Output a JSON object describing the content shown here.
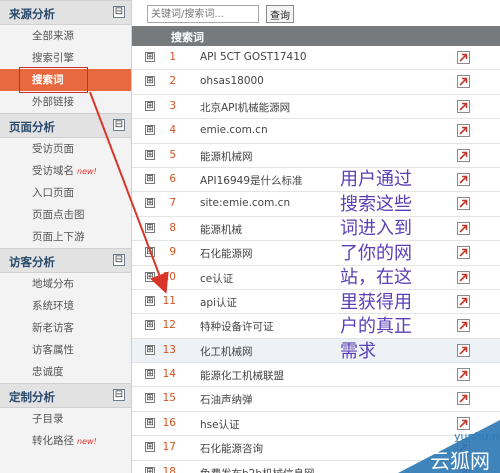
{
  "sidebar": {
    "sections": [
      {
        "title": "来源分析",
        "toggle": "⊟",
        "items": [
          {
            "label": "全部来源",
            "active": false,
            "new": false
          },
          {
            "label": "搜索引擎",
            "active": false,
            "new": false
          },
          {
            "label": "搜索词",
            "active": true,
            "new": false
          },
          {
            "label": "外部链接",
            "active": false,
            "new": false
          }
        ]
      },
      {
        "title": "页面分析",
        "toggle": "⊟",
        "items": [
          {
            "label": "受访页面",
            "active": false,
            "new": false
          },
          {
            "label": "受访域名",
            "active": false,
            "new": true
          },
          {
            "label": "入口页面",
            "active": false,
            "new": false
          },
          {
            "label": "页面点击图",
            "active": false,
            "new": false
          },
          {
            "label": "页面上下游",
            "active": false,
            "new": false
          }
        ]
      },
      {
        "title": "访客分析",
        "toggle": "⊟",
        "items": [
          {
            "label": "地域分布",
            "active": false,
            "new": false
          },
          {
            "label": "系统环境",
            "active": false,
            "new": false
          },
          {
            "label": "新老访客",
            "active": false,
            "new": false
          },
          {
            "label": "访客属性",
            "active": false,
            "new": false
          },
          {
            "label": "忠诚度",
            "active": false,
            "new": false
          }
        ]
      },
      {
        "title": "定制分析",
        "toggle": "⊟",
        "items": [
          {
            "label": "子目录",
            "active": false,
            "new": false
          },
          {
            "label": "转化路径",
            "active": false,
            "new": true
          }
        ]
      }
    ],
    "new_badge": "new!"
  },
  "search": {
    "placeholder": "关键词/搜索词...",
    "button_label": "查询"
  },
  "table": {
    "header": "搜索词",
    "rows": [
      {
        "num": "1",
        "keyword": "API 5CT GOST17410"
      },
      {
        "num": "2",
        "keyword": "ohsas18000"
      },
      {
        "num": "3",
        "keyword": "北京API机械能源网"
      },
      {
        "num": "4",
        "keyword": "emie.com.cn"
      },
      {
        "num": "5",
        "keyword": "能源机械网"
      },
      {
        "num": "6",
        "keyword": "API16949是什么标准"
      },
      {
        "num": "7",
        "keyword": "site:emie.com.cn"
      },
      {
        "num": "8",
        "keyword": "能源机械"
      },
      {
        "num": "9",
        "keyword": "石化能源网"
      },
      {
        "num": "10",
        "keyword": "ce认证"
      },
      {
        "num": "11",
        "keyword": "api认证"
      },
      {
        "num": "12",
        "keyword": "特种设备许可证"
      },
      {
        "num": "13",
        "keyword": "化工机械网"
      },
      {
        "num": "14",
        "keyword": "能源化工机械联盟"
      },
      {
        "num": "15",
        "keyword": "石油声纳弹"
      },
      {
        "num": "16",
        "keyword": "hse认证"
      },
      {
        "num": "17",
        "keyword": "石化能源咨询"
      },
      {
        "num": "18",
        "keyword": "免费发布b2b机械信息网"
      }
    ],
    "expand_glyph": "⊞"
  },
  "annotation": {
    "lines": [
      "用户通过",
      "搜索这些",
      "词进入到",
      "了你的网",
      "站，在这",
      "里获得用",
      "户的真正",
      "需求"
    ]
  },
  "watermark": {
    "url": "yunhu.net",
    "name": "云狐网"
  },
  "colors": {
    "active_item": "#e8693f",
    "table_header": "#777a7d",
    "row_number": "#d0521e",
    "annotation": "#5a3fb7",
    "arrow": "#d9352a",
    "watermark": "#2f7ab5"
  }
}
